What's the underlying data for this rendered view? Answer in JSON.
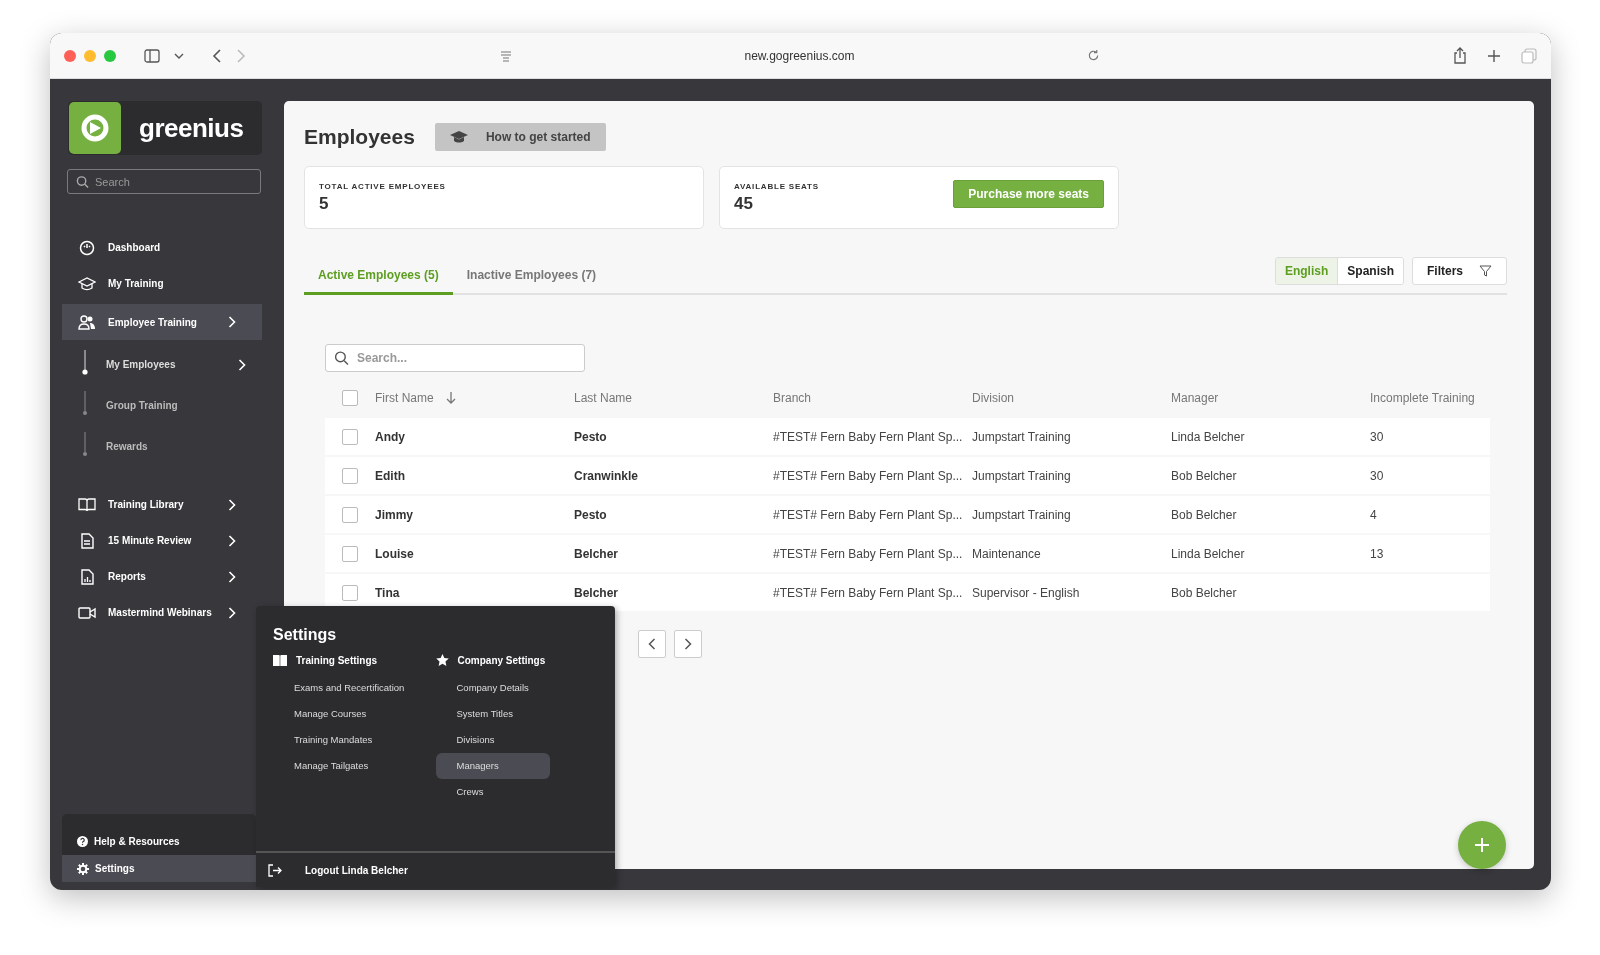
{
  "browser": {
    "url": "new.gogreenius.com"
  },
  "sidebar": {
    "logo_text": "greenius",
    "search": {
      "placeholder": "Search"
    },
    "nav": [
      {
        "label": "Dashboard",
        "selected": false,
        "expandable": false
      },
      {
        "label": "My Training",
        "selected": false,
        "expandable": false
      },
      {
        "label": "Employee Training",
        "selected": true,
        "expandable": true,
        "children": [
          {
            "label": "My Employees",
            "selected": true,
            "expandable": true
          },
          {
            "label": "Group Training",
            "selected": false,
            "expandable": false
          },
          {
            "label": "Rewards",
            "selected": false,
            "expandable": false
          }
        ]
      },
      {
        "label": "Training Library",
        "selected": false,
        "expandable": true
      },
      {
        "label": "15 Minute Review",
        "selected": false,
        "expandable": true
      },
      {
        "label": "Reports",
        "selected": false,
        "expandable": true
      },
      {
        "label": "Mastermind Webinars",
        "selected": false,
        "expandable": true
      }
    ],
    "footer": [
      {
        "label": "Help & Resources",
        "selected": false
      },
      {
        "label": "Settings",
        "selected": true
      }
    ]
  },
  "page": {
    "title": "Employees",
    "help_button": "How to get started",
    "stats": [
      {
        "label": "TOTAL ACTIVE EMPLOYEES",
        "value": "5"
      },
      {
        "label": "AVAILABLE SEATS",
        "value": "45",
        "action": "Purchase more seats"
      }
    ],
    "tabs": [
      {
        "label": "Active Employees (5)",
        "selected": true
      },
      {
        "label": "Inactive Employees (7)",
        "selected": false
      }
    ],
    "languages": [
      {
        "label": "English",
        "selected": true
      },
      {
        "label": "Spanish",
        "selected": false
      }
    ],
    "filters_button": "Filters",
    "table": {
      "search": {
        "placeholder": "Search..."
      },
      "select_all_checked": false,
      "columns": [
        "First Name",
        "Last Name",
        "Branch",
        "Division",
        "Manager",
        "Incomplete Training"
      ],
      "rows": [
        {
          "checked": false,
          "cells": [
            "Andy",
            "Pesto",
            "#TEST# Fern Baby Fern Plant Sp...",
            "Jumpstart Training",
            "Linda Belcher",
            "30"
          ]
        },
        {
          "checked": false,
          "cells": [
            "Edith",
            "Cranwinkle",
            "#TEST# Fern Baby Fern Plant Sp...",
            "Jumpstart Training",
            "Bob Belcher",
            "30"
          ]
        },
        {
          "checked": false,
          "cells": [
            "Jimmy",
            "Pesto",
            "#TEST# Fern Baby Fern Plant Sp...",
            "Jumpstart Training",
            "Bob Belcher",
            "4"
          ]
        },
        {
          "checked": false,
          "cells": [
            "Louise",
            "Belcher",
            "#TEST# Fern Baby Fern Plant Sp...",
            "Maintenance",
            "Linda Belcher",
            "13"
          ]
        },
        {
          "checked": false,
          "cells": [
            "Tina",
            "Belcher",
            "#TEST# Fern Baby Fern Plant Sp...",
            "Supervisor - English",
            "Bob Belcher"
          ]
        }
      ]
    }
  },
  "settings_menu": {
    "title": "Settings",
    "sections": [
      {
        "title": "Training Settings",
        "items": [
          {
            "label": "Exams and Recertification",
            "selected": false
          },
          {
            "label": "Manage Courses",
            "selected": false
          },
          {
            "label": "Training Mandates",
            "selected": false
          },
          {
            "label": "Manage Tailgates",
            "selected": false
          }
        ]
      },
      {
        "title": "Company Settings",
        "items": [
          {
            "label": "Company Details",
            "selected": false
          },
          {
            "label": "System Titles",
            "selected": false
          },
          {
            "label": "Divisions",
            "selected": false
          },
          {
            "label": "Managers",
            "selected": true
          },
          {
            "label": "Crews",
            "selected": false
          }
        ]
      }
    ],
    "logout": "Logout Linda Belcher"
  }
}
